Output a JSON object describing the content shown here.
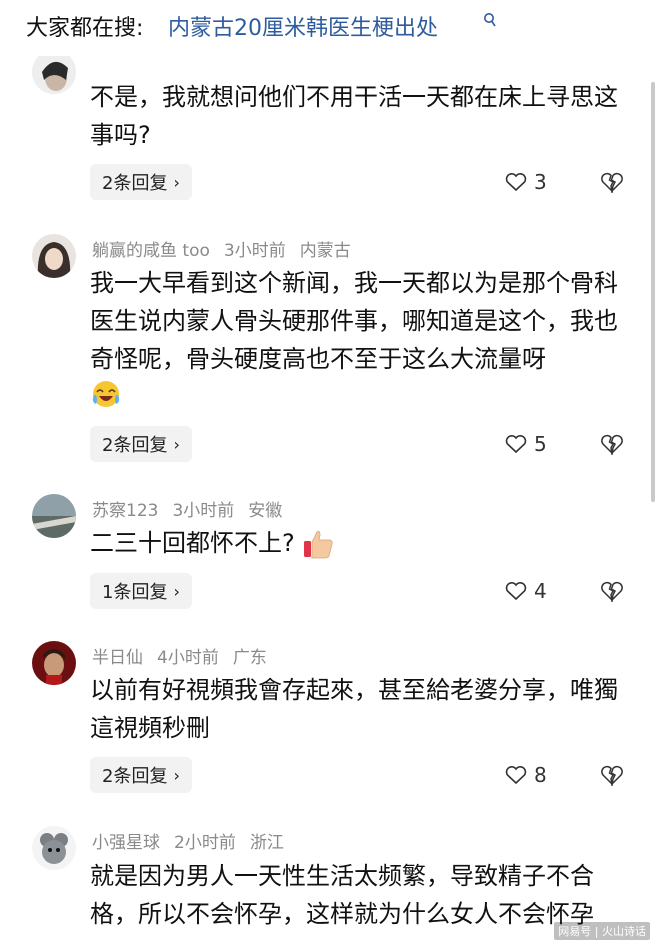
{
  "search": {
    "label": "大家都在搜:",
    "query": "内蒙古20厘米韩医生梗出处",
    "icon": "search-icon"
  },
  "comments": [
    {
      "username": "",
      "time": "",
      "location": "",
      "text": "不是，我就想问他们不用干活一天都在床上寻思这事吗?",
      "replies": "2条回复",
      "likes": "3"
    },
    {
      "username": "躺赢的咸鱼 too",
      "time": "3小时前",
      "location": "内蒙古",
      "text": "我一大早看到这个新闻，我一天都以为是那个骨科医生说内蒙人骨头硬那件事，哪知道是这个，我也奇怪呢，骨头硬度高也不至于这么大流量呀",
      "replies": "2条回复",
      "likes": "5"
    },
    {
      "username": "苏察123",
      "time": "3小时前",
      "location": "安徽",
      "text": "二三十回都怀不上?",
      "replies": "1条回复",
      "likes": "4"
    },
    {
      "username": "半日仙",
      "time": "4小时前",
      "location": "广东",
      "text": "以前有好視頻我會存起來，甚至給老婆分享，唯獨這視頻秒刪",
      "replies": "2条回复",
      "likes": "8"
    },
    {
      "username": "小强星球",
      "time": "2小时前",
      "location": "浙江",
      "text": "就是因为男人一天性生活太频繁，导致精子不合格，所以不会怀孕，这样就为什么女人不会怀孕"
    }
  ],
  "watermark": "网易号 | 火山诗话",
  "colors": {
    "link": "#2f5c9e",
    "meta": "#8a8a8a",
    "reply_bg": "#f2f2f2"
  }
}
